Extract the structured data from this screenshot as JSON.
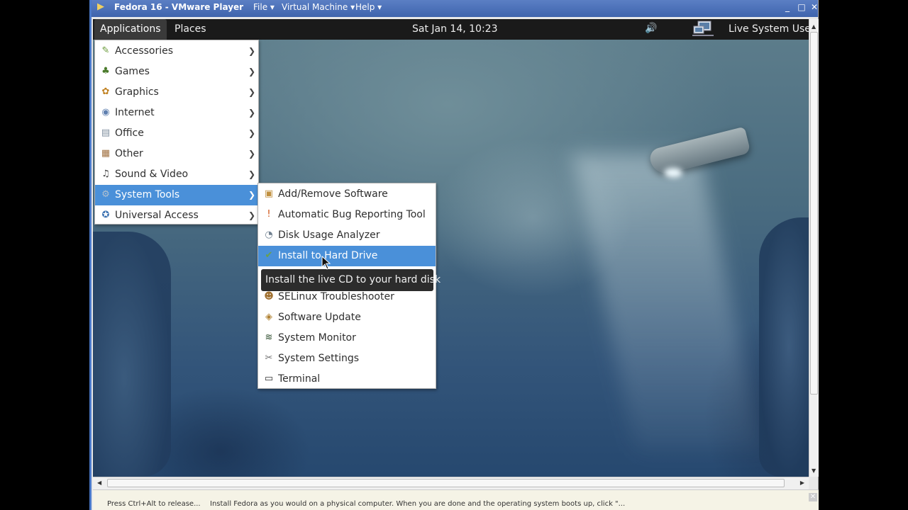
{
  "vm": {
    "title": "Fedora 16 - VMware Player",
    "menus": [
      "File ▾",
      "Virtual Machine ▾",
      "Help ▾"
    ],
    "window_buttons": [
      "_",
      "□",
      "✕"
    ],
    "hint_left": "Press Ctrl+Alt to release...",
    "hint_right": "Install Fedora as you would on a physical computer. When you are done and the operating system boots up, click \"..."
  },
  "panel": {
    "applications": "Applications",
    "places": "Places",
    "clock": "Sat Jan 14, 10:23",
    "user": "Live System User",
    "volume_icon": "🔊"
  },
  "apps_menu": {
    "items": [
      {
        "label": "Accessories",
        "icon": "✎",
        "icon_color": "#6a9a3a"
      },
      {
        "label": "Games",
        "icon": "♣",
        "icon_color": "#4a7a2a"
      },
      {
        "label": "Graphics",
        "icon": "✿",
        "icon_color": "#c08020"
      },
      {
        "label": "Internet",
        "icon": "◉",
        "icon_color": "#6080b0"
      },
      {
        "label": "Office",
        "icon": "▤",
        "icon_color": "#8090a0"
      },
      {
        "label": "Other",
        "icon": "▦",
        "icon_color": "#a07040"
      },
      {
        "label": "Sound & Video",
        "icon": "♫",
        "icon_color": "#404040"
      },
      {
        "label": "System Tools",
        "icon": "⚙",
        "icon_color": "#b0c0d0"
      },
      {
        "label": "Universal Access",
        "icon": "✪",
        "icon_color": "#3a70b0"
      }
    ],
    "selected_index": 7
  },
  "system_tools_menu": {
    "items": [
      {
        "label": "Add/Remove Software",
        "icon": "▣",
        "icon_color": "#c09040"
      },
      {
        "label": "Automatic Bug Reporting Tool",
        "icon": "!",
        "icon_color": "#d05010"
      },
      {
        "label": "Disk Usage Analyzer",
        "icon": "◔",
        "icon_color": "#708090"
      },
      {
        "label": "Install to Hard Drive",
        "icon": "✔",
        "icon_color": "#6aa04a"
      },
      {
        "label": "",
        "icon": "",
        "icon_color": "#ffffff"
      },
      {
        "label": "SELinux Troubleshooter",
        "icon": "☻",
        "icon_color": "#a07030"
      },
      {
        "label": "Software Update",
        "icon": "◈",
        "icon_color": "#b08030"
      },
      {
        "label": "System Monitor",
        "icon": "≋",
        "icon_color": "#2a4a2a"
      },
      {
        "label": "System Settings",
        "icon": "✂",
        "icon_color": "#707070"
      },
      {
        "label": "Terminal",
        "icon": "▭",
        "icon_color": "#303030"
      }
    ],
    "selected_index": 3
  },
  "tooltip": "Install the live CD to your hard disk"
}
